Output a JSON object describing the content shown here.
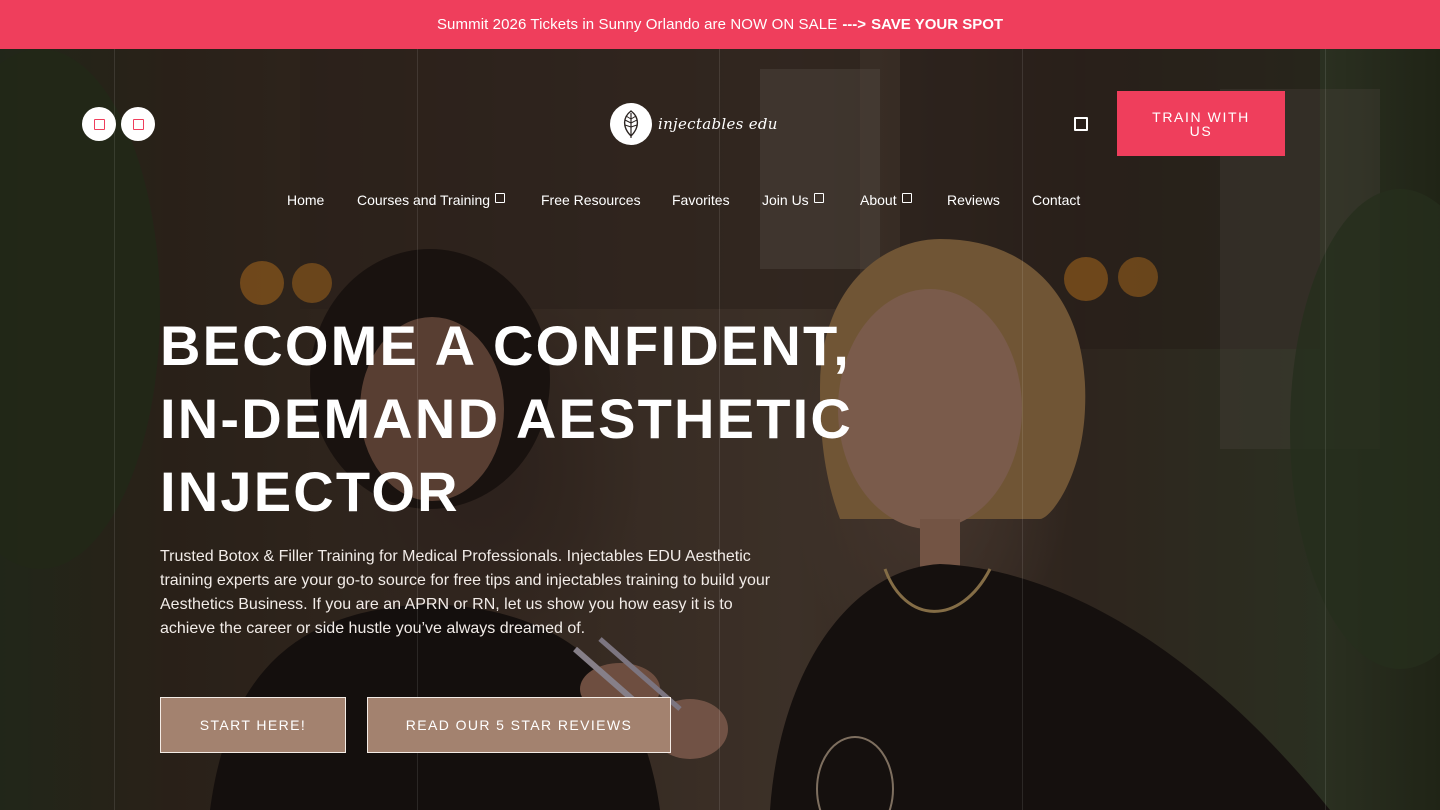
{
  "announcement": {
    "lead": "Summit 2026 Tickets in Sunny Orlando are NOW ON SALE",
    "arrow": "--->",
    "cta": "SAVE YOUR SPOT"
  },
  "header": {
    "social": [
      {
        "icon": "social-icon"
      },
      {
        "icon": "social-icon"
      }
    ],
    "logo_text": "injectables edu",
    "cart_icon": "cart-icon",
    "train_button": "TRAIN WITH US"
  },
  "nav": {
    "items": [
      {
        "label": "Home",
        "dropdown": false
      },
      {
        "label": "Courses and Training",
        "dropdown": true
      },
      {
        "label": "Free Resources",
        "dropdown": false
      },
      {
        "label": "Favorites",
        "dropdown": false
      },
      {
        "label": "Join Us",
        "dropdown": true
      },
      {
        "label": "About",
        "dropdown": true
      },
      {
        "label": "Reviews",
        "dropdown": false
      },
      {
        "label": "Contact",
        "dropdown": false
      }
    ]
  },
  "hero": {
    "headline": [
      "BECOME A CONFIDENT,",
      "IN-DEMAND AESTHETIC",
      "INJECTOR"
    ],
    "intro": "Trusted Botox & Filler Training for Medical Professionals. Injectables EDU Aesthetic training experts are your go-to source for free tips and injectables training to build your Aesthetics Business. If you are an APRN or RN, let us show you how easy it is to achieve the career or side hustle you’ve always dreamed of.",
    "primary_button": "START HERE!",
    "secondary_button": "READ OUR 5 STAR REVIEWS"
  },
  "colors": {
    "accent": "#ef3e5c",
    "button_fill": "#a3826f"
  }
}
